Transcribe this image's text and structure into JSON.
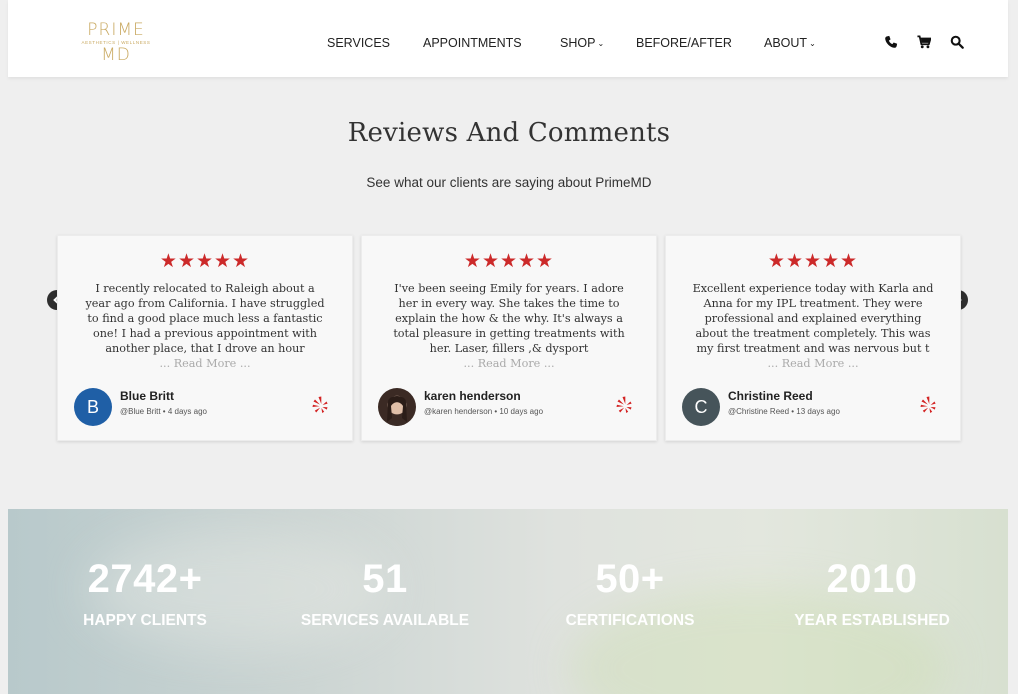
{
  "brand": {
    "logo_top": "PRIME",
    "logo_tagline": "AESTHETICS | WELLNESS",
    "logo_bottom": "MD"
  },
  "nav": {
    "services": "SERVICES",
    "appointments": "APPOINTMENTS",
    "shop": "SHOP",
    "before_after": "BEFORE/AFTER",
    "about": "ABOUT",
    "icons": [
      "phone-icon",
      "cart-icon",
      "search-icon"
    ]
  },
  "reviews": {
    "title": "Reviews And Comments",
    "subtitle": "See what our clients are saying about PrimeMD",
    "stars": "★★★★★",
    "read_more": "... Read More ...",
    "items": [
      {
        "lines": [
          "I recently relocated to Raleigh about a",
          "year ago from California. I have struggled",
          "to find a good place much less a fantastic",
          "one! I had a previous appointment with",
          "another place, that I drove an hour"
        ],
        "author": "Blue Britt",
        "handle": "@Blue Britt",
        "time": "4 days ago",
        "avatar_letter": "B",
        "avatar_color": "#1f5fa6"
      },
      {
        "lines": [
          "I've been seeing Emily for years. I adore",
          "her in every way. She takes the time to",
          "explain the how & the why. It's always a",
          "total pleasure in getting treatments with",
          "her. Laser, fillers ,& dysport"
        ],
        "author": "karen henderson",
        "handle": "@karen henderson",
        "time": "10 days ago",
        "avatar_letter": "",
        "avatar_color": "#4a3a33"
      },
      {
        "lines": [
          "Excellent experience today with Karla and",
          "Anna for my IPL treatment. They were",
          "professional and explained everything",
          "about the treatment completely. This was",
          "my first treatment and was nervous but t"
        ],
        "author": "Christine Reed",
        "handle": "@Christine Reed",
        "time": "13 days ago",
        "avatar_letter": "C",
        "avatar_color": "#46545a"
      }
    ]
  },
  "stats": [
    {
      "value": "2742+",
      "label": "HAPPY CLIENTS"
    },
    {
      "value": "51",
      "label": "SERVICES AVAILABLE"
    },
    {
      "value": "50+",
      "label": "CERTIFICATIONS"
    },
    {
      "value": "2010",
      "label": "YEAR ESTABLISHED"
    }
  ],
  "colors": {
    "gold": "#c9a961",
    "star_red": "#cc2a2a",
    "yelp_red": "#d32323"
  }
}
